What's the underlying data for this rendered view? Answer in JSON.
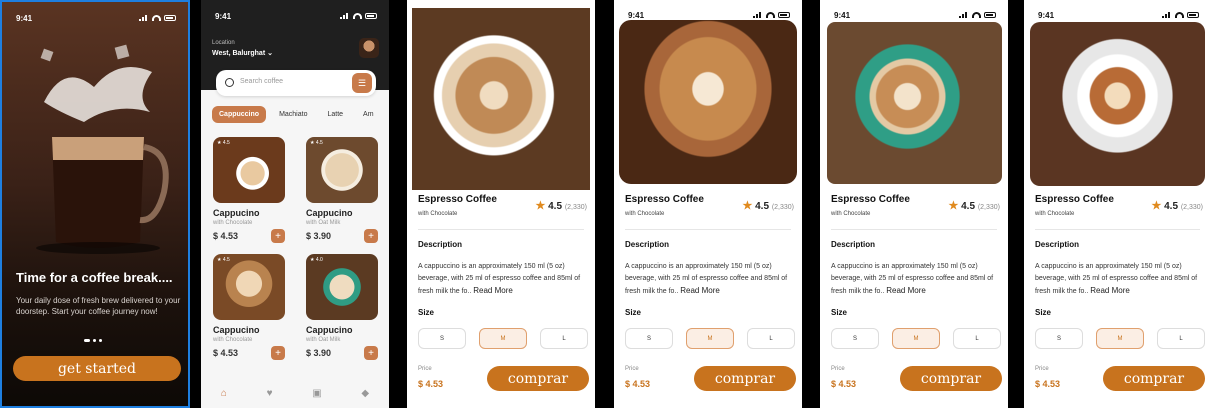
{
  "status_time": "9:41",
  "splash": {
    "title": "Time for a coffee break....",
    "subtitle": "Your daily dose of fresh brew delivered to your doorstep. Start your coffee journey now!",
    "cta": "get started"
  },
  "home": {
    "location_label": "Location",
    "location_value": "West, Balurghat",
    "search_placeholder": "Search coffee",
    "categories": [
      "Cappuccino",
      "Machiato",
      "Latte",
      "Am"
    ],
    "products": [
      {
        "rating": "4.5",
        "name": "Cappucino",
        "variant": "with Chocolate",
        "price": "$ 4.53"
      },
      {
        "rating": "4.5",
        "name": "Cappucino",
        "variant": "with Oat Milk",
        "price": "$ 3.90"
      },
      {
        "rating": "4.5",
        "name": "Cappucino",
        "variant": "with Chocolate",
        "price": "$ 4.53"
      },
      {
        "rating": "4.0",
        "name": "Cappucino",
        "variant": "with Oat Milk",
        "price": "$ 3.90"
      }
    ]
  },
  "detail": {
    "name": "Espresso Coffee",
    "variant": "with Chocolate",
    "rating": "4.5",
    "rating_count": "(2,330)",
    "description_label": "Description",
    "description": "A cappuccino is an approximately 150 ml (5 oz) beverage, with 25 ml of espresso coffee and 85ml of fresh milk the fo..",
    "read_more": "Read More",
    "size_label": "Size",
    "sizes": [
      "S",
      "M",
      "L"
    ],
    "selected_size": "M",
    "price_label": "Price",
    "price": "$ 4.53",
    "cta": "comprar"
  },
  "colors": {
    "accent": "#c8731e",
    "dark": "#1f1f1f"
  }
}
